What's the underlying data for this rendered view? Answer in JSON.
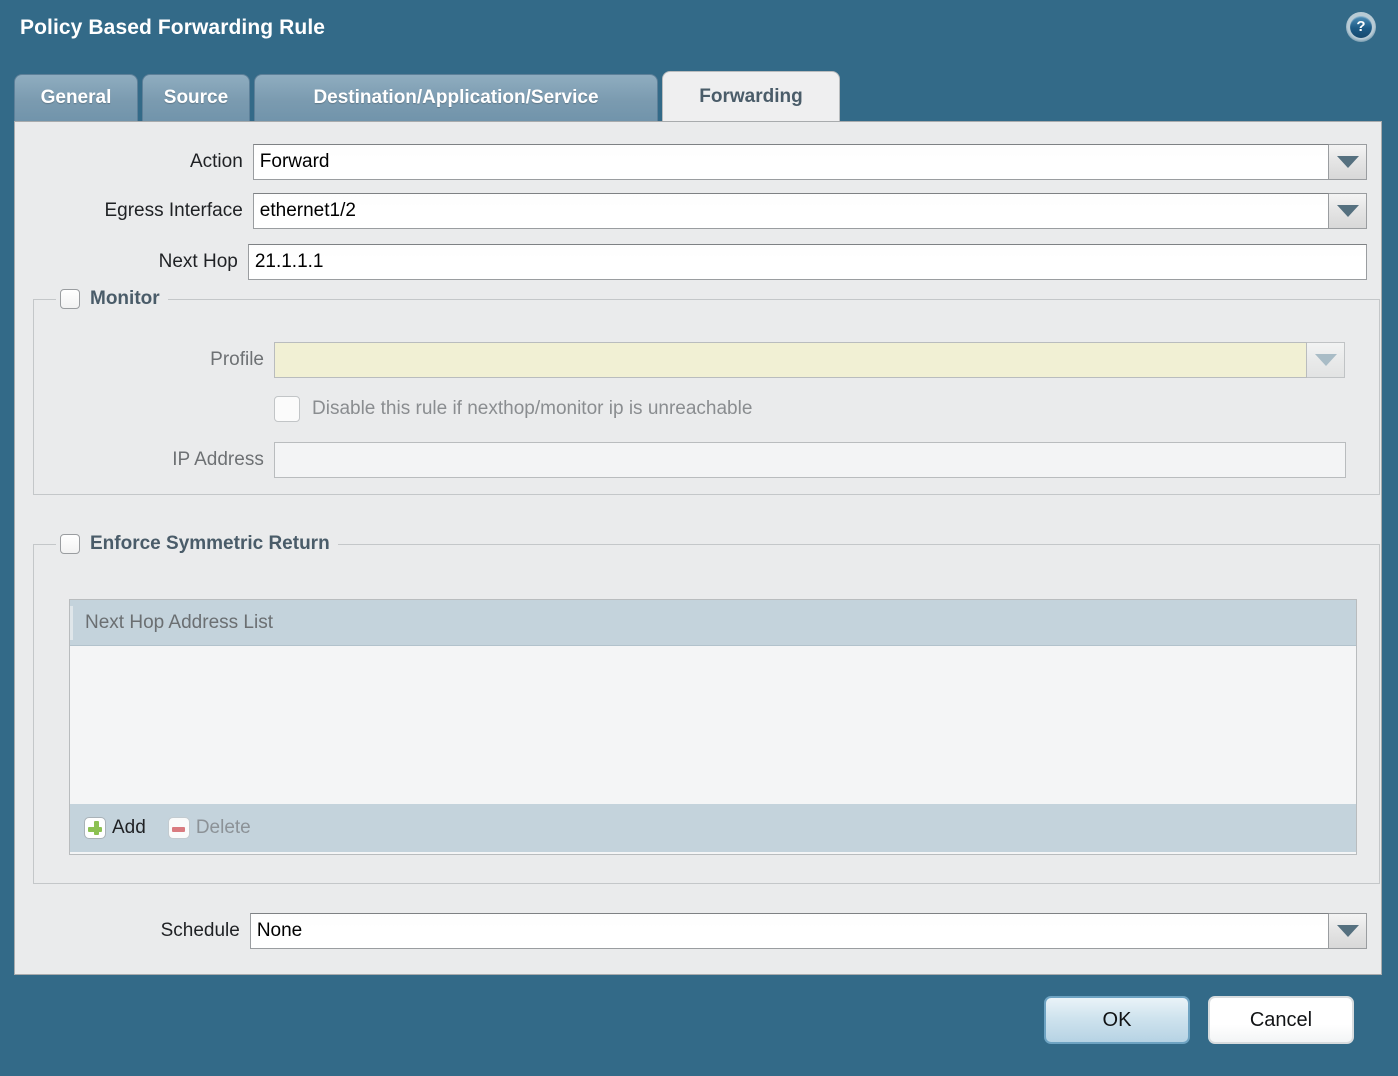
{
  "dialog": {
    "title": "Policy Based Forwarding Rule",
    "help_icon_glyph": "?"
  },
  "tabs": [
    {
      "label": "General",
      "active": false
    },
    {
      "label": "Source",
      "active": false
    },
    {
      "label": "Destination/Application/Service",
      "active": false
    },
    {
      "label": "Forwarding",
      "active": true
    }
  ],
  "form": {
    "action": {
      "label": "Action",
      "value": "Forward",
      "control": "dropdown"
    },
    "egress_interface": {
      "label": "Egress Interface",
      "value": "ethernet1/2",
      "control": "dropdown"
    },
    "next_hop": {
      "label": "Next Hop",
      "value": "21.1.1.1",
      "control": "text"
    },
    "schedule": {
      "label": "Schedule",
      "value": "None",
      "control": "dropdown"
    }
  },
  "monitor": {
    "legend": "Monitor",
    "checked": false,
    "profile": {
      "label": "Profile",
      "value": "",
      "control": "dropdown",
      "state": "disabled-required"
    },
    "disable_rule": {
      "label": "Disable this rule if nexthop/monitor ip is unreachable",
      "checked": false,
      "state": "disabled"
    },
    "ip_address": {
      "label": "IP Address",
      "value": "",
      "control": "text",
      "state": "disabled"
    }
  },
  "symmetric_return": {
    "legend": "Enforce Symmetric Return",
    "checked": false,
    "list": {
      "columns": [
        "Next Hop Address List"
      ],
      "rows": [],
      "toolbar": [
        {
          "label": "Add",
          "icon": "plus-icon",
          "enabled": true
        },
        {
          "label": "Delete",
          "icon": "minus-icon",
          "enabled": false
        }
      ]
    }
  },
  "footer": {
    "ok_label": "OK",
    "cancel_label": "Cancel"
  },
  "colors": {
    "dialog_chrome": "#336a88",
    "tab_inactive": "#7b9bb0",
    "panel_bg": "#eaebec",
    "list_header": "#c4d3dc",
    "required_field": "#f1f0d4",
    "add_icon_green": "#8cc152",
    "delete_icon_red": "#d97b80"
  }
}
